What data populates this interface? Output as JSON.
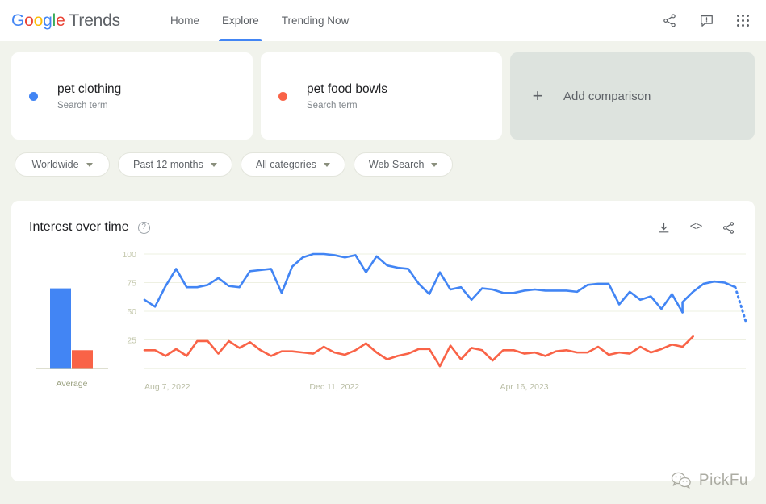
{
  "header": {
    "logo": {
      "google": "Google",
      "trends": "Trends"
    },
    "nav": [
      {
        "label": "Home",
        "active": false
      },
      {
        "label": "Explore",
        "active": true
      },
      {
        "label": "Trending Now",
        "active": false
      }
    ],
    "actions": [
      {
        "name": "share-icon",
        "label": "Share"
      },
      {
        "name": "feedback-icon",
        "label": "Send feedback"
      },
      {
        "name": "apps-grid-icon",
        "label": "Google apps"
      }
    ]
  },
  "terms": [
    {
      "name": "pet clothing",
      "type": "Search term",
      "color": "#4285f4"
    },
    {
      "name": "pet food bowls",
      "type": "Search term",
      "color": "#f96347"
    }
  ],
  "add_comparison": {
    "plus": "+",
    "label": "Add comparison"
  },
  "filters": [
    {
      "label": "Worldwide"
    },
    {
      "label": "Past 12 months"
    },
    {
      "label": "All categories"
    },
    {
      "label": "Web Search"
    }
  ],
  "chart_card": {
    "title": "Interest over time",
    "help": "?",
    "tools": [
      {
        "name": "download-icon"
      },
      {
        "name": "embed-icon",
        "glyph": "<>"
      },
      {
        "name": "share-icon"
      }
    ]
  },
  "watermark": {
    "text": "PickFu"
  },
  "chart_data": {
    "type": "line",
    "title": "Interest over time",
    "xlabel": "",
    "ylabel": "",
    "ylim": [
      0,
      100
    ],
    "yticks": [
      25,
      50,
      75,
      100
    ],
    "grid": true,
    "legend_position": "cards-above",
    "x_tick_labels": [
      "Aug 7, 2022",
      "Dec 11, 2022",
      "Apr 16, 2023"
    ],
    "x_tick_indices": [
      0,
      18,
      36
    ],
    "x": [
      "Aug 7, 2022",
      "Aug 14, 2022",
      "Aug 21, 2022",
      "Aug 28, 2022",
      "Sep 4, 2022",
      "Sep 11, 2022",
      "Sep 18, 2022",
      "Sep 25, 2022",
      "Oct 2, 2022",
      "Oct 9, 2022",
      "Oct 16, 2022",
      "Oct 23, 2022",
      "Oct 30, 2022",
      "Nov 6, 2022",
      "Nov 13, 2022",
      "Nov 20, 2022",
      "Nov 27, 2022",
      "Dec 4, 2022",
      "Dec 11, 2022",
      "Dec 18, 2022",
      "Dec 25, 2022",
      "Jan 1, 2023",
      "Jan 8, 2023",
      "Jan 15, 2023",
      "Jan 22, 2023",
      "Jan 29, 2023",
      "Feb 5, 2023",
      "Feb 12, 2023",
      "Feb 19, 2023",
      "Feb 26, 2023",
      "Mar 5, 2023",
      "Mar 12, 2023",
      "Mar 19, 2023",
      "Mar 26, 2023",
      "Apr 2, 2023",
      "Apr 9, 2023",
      "Apr 16, 2023",
      "Apr 23, 2023",
      "Apr 30, 2023",
      "May 7, 2023",
      "May 14, 2023",
      "May 21, 2023",
      "May 28, 2023",
      "Jun 4, 2023",
      "Jun 11, 2023",
      "Jun 18, 2023",
      "Jun 25, 2023",
      "Jul 2, 2023",
      "Jul 9, 2023",
      "Jul 16, 2023",
      "Jul 23, 2023",
      "Jul 30, 2023"
    ],
    "series": [
      {
        "name": "pet clothing",
        "color": "#4285f4",
        "average": 70,
        "partial_from_index": 50,
        "values": [
          60,
          54,
          72,
          87,
          71,
          71,
          73,
          79,
          72,
          71,
          85,
          86,
          87,
          66,
          89,
          97,
          100,
          100,
          99,
          97,
          99,
          84,
          98,
          90,
          88,
          87,
          74,
          65,
          84,
          69,
          71,
          60,
          70,
          69,
          66,
          66,
          68,
          69,
          68,
          68,
          68,
          67,
          73,
          74,
          74,
          56,
          67,
          60,
          63,
          52,
          65,
          49
        ],
        "tail_values": [
          58,
          67,
          74,
          76,
          75,
          71,
          41
        ]
      },
      {
        "name": "pet food bowls",
        "color": "#f96347",
        "average": 16,
        "values": [
          16,
          16,
          11,
          17,
          11,
          24,
          24,
          13,
          24,
          18,
          23,
          16,
          11,
          15,
          15,
          14,
          13,
          19,
          14,
          12,
          16,
          22,
          14,
          8,
          11,
          13,
          17,
          17,
          2,
          20,
          8,
          18,
          16,
          7,
          16,
          16,
          13,
          14,
          11,
          15,
          16,
          14,
          14,
          19,
          12,
          14,
          13,
          19,
          14,
          17,
          21,
          19,
          28
        ]
      }
    ],
    "average_bar_chart": {
      "label": "Average",
      "bars": [
        {
          "name": "pet clothing",
          "value": 70,
          "color": "#4285f4"
        },
        {
          "name": "pet food bowls",
          "value": 16,
          "color": "#f96347"
        }
      ]
    }
  }
}
